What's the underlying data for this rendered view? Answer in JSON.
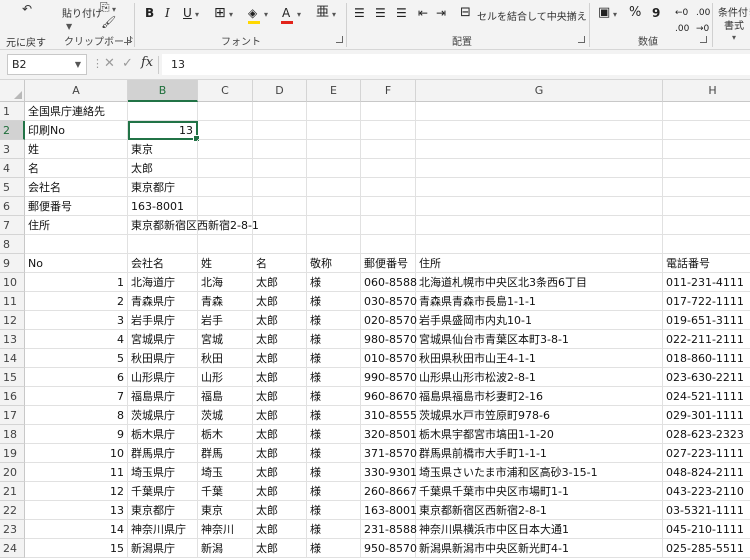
{
  "ribbon": {
    "clipboard": {
      "group": "クリップボード",
      "undo_label": "元に戻す",
      "paste_label": "貼り付け"
    },
    "font": {
      "group": "フォント",
      "bold": "B",
      "italic": "I",
      "underline": "U",
      "font_color_letter": "A"
    },
    "alignment": {
      "group": "配置",
      "merge_label": "セルを結合して中央揃え"
    },
    "number": {
      "group": "数値",
      "percent": "%",
      "comma": "9"
    },
    "styles": {
      "conditional_label": "条件付き",
      "conditional_label2": "書式"
    },
    "colors": {
      "fill": "#ffd800",
      "font": "#e2231a",
      "accent": "#217346"
    }
  },
  "formula_bar": {
    "name_box": "B2",
    "formula": "13",
    "fx": "fx"
  },
  "columns": [
    "A",
    "B",
    "C",
    "D",
    "E",
    "F",
    "G",
    "H"
  ],
  "active_cell": "B2",
  "rows": [
    {
      "n": "1",
      "a": "全国県庁連絡先"
    },
    {
      "n": "2",
      "a": "印刷No",
      "b": "13"
    },
    {
      "n": "3",
      "a": "姓",
      "b": "東京"
    },
    {
      "n": "4",
      "a": "名",
      "b": "太郎"
    },
    {
      "n": "5",
      "a": "会社名",
      "b": "東京都庁"
    },
    {
      "n": "6",
      "a": "郵便番号",
      "b": "163-8001"
    },
    {
      "n": "7",
      "a": "住所",
      "b": "東京都新宿区西新宿2-8-1"
    },
    {
      "n": "8"
    },
    {
      "n": "9",
      "a": "No",
      "b": "会社名",
      "c": "姓",
      "d": "名",
      "e": "敬称",
      "f": "郵便番号",
      "g": "住所",
      "h": "電話番号"
    },
    {
      "n": "10",
      "a": "1",
      "b": "北海道庁",
      "c": "北海",
      "d": "太郎",
      "e": "様",
      "f": "060-8588",
      "g": "北海道札幌市中央区北3条西6丁目",
      "h": "011-231-4111"
    },
    {
      "n": "11",
      "a": "2",
      "b": "青森県庁",
      "c": "青森",
      "d": "太郎",
      "e": "様",
      "f": "030-8570",
      "g": "青森県青森市長島1-1-1",
      "h": "017-722-1111"
    },
    {
      "n": "12",
      "a": "3",
      "b": "岩手県庁",
      "c": "岩手",
      "d": "太郎",
      "e": "様",
      "f": "020-8570",
      "g": "岩手県盛岡市内丸10-1",
      "h": "019-651-3111"
    },
    {
      "n": "13",
      "a": "4",
      "b": "宮城県庁",
      "c": "宮城",
      "d": "太郎",
      "e": "様",
      "f": "980-8570",
      "g": "宮城県仙台市青葉区本町3-8-1",
      "h": "022-211-2111"
    },
    {
      "n": "14",
      "a": "5",
      "b": "秋田県庁",
      "c": "秋田",
      "d": "太郎",
      "e": "様",
      "f": "010-8570",
      "g": "秋田県秋田市山王4-1-1",
      "h": "018-860-1111"
    },
    {
      "n": "15",
      "a": "6",
      "b": "山形県庁",
      "c": "山形",
      "d": "太郎",
      "e": "様",
      "f": "990-8570",
      "g": "山形県山形市松波2-8-1",
      "h": "023-630-2211"
    },
    {
      "n": "16",
      "a": "7",
      "b": "福島県庁",
      "c": "福島",
      "d": "太郎",
      "e": "様",
      "f": "960-8670",
      "g": "福島県福島市杉妻町2-16",
      "h": "024-521-1111"
    },
    {
      "n": "17",
      "a": "8",
      "b": "茨城県庁",
      "c": "茨城",
      "d": "太郎",
      "e": "様",
      "f": "310-8555",
      "g": "茨城県水戸市笠原町978-6",
      "h": "029-301-1111"
    },
    {
      "n": "18",
      "a": "9",
      "b": "栃木県庁",
      "c": "栃木",
      "d": "太郎",
      "e": "様",
      "f": "320-8501",
      "g": "栃木県宇都宮市塙田1-1-20",
      "h": "028-623-2323"
    },
    {
      "n": "19",
      "a": "10",
      "b": "群馬県庁",
      "c": "群馬",
      "d": "太郎",
      "e": "様",
      "f": "371-8570",
      "g": "群馬県前橋市大手町1-1-1",
      "h": "027-223-1111"
    },
    {
      "n": "20",
      "a": "11",
      "b": "埼玉県庁",
      "c": "埼玉",
      "d": "太郎",
      "e": "様",
      "f": "330-9301",
      "g": "埼玉県さいたま市浦和区高砂3-15-1",
      "h": "048-824-2111"
    },
    {
      "n": "21",
      "a": "12",
      "b": "千葉県庁",
      "c": "千葉",
      "d": "太郎",
      "e": "様",
      "f": "260-8667",
      "g": "千葉県千葉市中央区市場町1-1",
      "h": "043-223-2110"
    },
    {
      "n": "22",
      "a": "13",
      "b": "東京都庁",
      "c": "東京",
      "d": "太郎",
      "e": "様",
      "f": "163-8001",
      "g": "東京都新宿区西新宿2-8-1",
      "h": "03-5321-1111"
    },
    {
      "n": "23",
      "a": "14",
      "b": "神奈川県庁",
      "c": "神奈川",
      "d": "太郎",
      "e": "様",
      "f": "231-8588",
      "g": "神奈川県横浜市中区日本大通1",
      "h": "045-210-1111"
    },
    {
      "n": "24",
      "a": "15",
      "b": "新潟県庁",
      "c": "新潟",
      "d": "太郎",
      "e": "様",
      "f": "950-8570",
      "g": "新潟県新潟市中央区新光町4-1",
      "h": "025-285-5511"
    }
  ]
}
